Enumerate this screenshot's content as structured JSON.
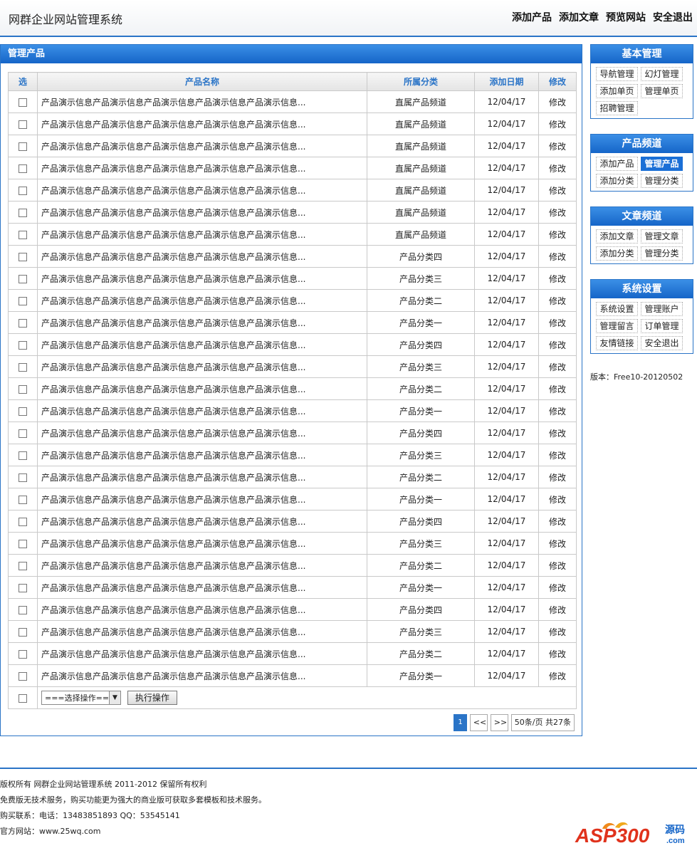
{
  "header": {
    "site_title": "网群企业网站管理系统",
    "nav": [
      "添加产品",
      "添加文章",
      "预览网站",
      "安全退出"
    ]
  },
  "main": {
    "title": "管理产品",
    "columns": [
      "选",
      "产品名称",
      "所属分类",
      "添加日期",
      "修改"
    ],
    "rows": [
      {
        "name": "产品演示信息产品演示信息产品演示信息产品演示信息产品演示信息...",
        "category": "直属产品频道",
        "date": "12/04/17",
        "edit": "修改"
      },
      {
        "name": "产品演示信息产品演示信息产品演示信息产品演示信息产品演示信息...",
        "category": "直属产品频道",
        "date": "12/04/17",
        "edit": "修改"
      },
      {
        "name": "产品演示信息产品演示信息产品演示信息产品演示信息产品演示信息...",
        "category": "直属产品频道",
        "date": "12/04/17",
        "edit": "修改"
      },
      {
        "name": "产品演示信息产品演示信息产品演示信息产品演示信息产品演示信息...",
        "category": "直属产品频道",
        "date": "12/04/17",
        "edit": "修改"
      },
      {
        "name": "产品演示信息产品演示信息产品演示信息产品演示信息产品演示信息...",
        "category": "直属产品频道",
        "date": "12/04/17",
        "edit": "修改"
      },
      {
        "name": "产品演示信息产品演示信息产品演示信息产品演示信息产品演示信息...",
        "category": "直属产品频道",
        "date": "12/04/17",
        "edit": "修改"
      },
      {
        "name": "产品演示信息产品演示信息产品演示信息产品演示信息产品演示信息...",
        "category": "直属产品频道",
        "date": "12/04/17",
        "edit": "修改"
      },
      {
        "name": "产品演示信息产品演示信息产品演示信息产品演示信息产品演示信息...",
        "category": "产品分类四",
        "date": "12/04/17",
        "edit": "修改"
      },
      {
        "name": "产品演示信息产品演示信息产品演示信息产品演示信息产品演示信息...",
        "category": "产品分类三",
        "date": "12/04/17",
        "edit": "修改"
      },
      {
        "name": "产品演示信息产品演示信息产品演示信息产品演示信息产品演示信息...",
        "category": "产品分类二",
        "date": "12/04/17",
        "edit": "修改"
      },
      {
        "name": "产品演示信息产品演示信息产品演示信息产品演示信息产品演示信息...",
        "category": "产品分类一",
        "date": "12/04/17",
        "edit": "修改"
      },
      {
        "name": "产品演示信息产品演示信息产品演示信息产品演示信息产品演示信息...",
        "category": "产品分类四",
        "date": "12/04/17",
        "edit": "修改"
      },
      {
        "name": "产品演示信息产品演示信息产品演示信息产品演示信息产品演示信息...",
        "category": "产品分类三",
        "date": "12/04/17",
        "edit": "修改"
      },
      {
        "name": "产品演示信息产品演示信息产品演示信息产品演示信息产品演示信息...",
        "category": "产品分类二",
        "date": "12/04/17",
        "edit": "修改"
      },
      {
        "name": "产品演示信息产品演示信息产品演示信息产品演示信息产品演示信息...",
        "category": "产品分类一",
        "date": "12/04/17",
        "edit": "修改"
      },
      {
        "name": "产品演示信息产品演示信息产品演示信息产品演示信息产品演示信息...",
        "category": "产品分类四",
        "date": "12/04/17",
        "edit": "修改"
      },
      {
        "name": "产品演示信息产品演示信息产品演示信息产品演示信息产品演示信息...",
        "category": "产品分类三",
        "date": "12/04/17",
        "edit": "修改"
      },
      {
        "name": "产品演示信息产品演示信息产品演示信息产品演示信息产品演示信息...",
        "category": "产品分类二",
        "date": "12/04/17",
        "edit": "修改"
      },
      {
        "name": "产品演示信息产品演示信息产品演示信息产品演示信息产品演示信息...",
        "category": "产品分类一",
        "date": "12/04/17",
        "edit": "修改"
      },
      {
        "name": "产品演示信息产品演示信息产品演示信息产品演示信息产品演示信息...",
        "category": "产品分类四",
        "date": "12/04/17",
        "edit": "修改"
      },
      {
        "name": "产品演示信息产品演示信息产品演示信息产品演示信息产品演示信息...",
        "category": "产品分类三",
        "date": "12/04/17",
        "edit": "修改"
      },
      {
        "name": "产品演示信息产品演示信息产品演示信息产品演示信息产品演示信息...",
        "category": "产品分类二",
        "date": "12/04/17",
        "edit": "修改"
      },
      {
        "name": "产品演示信息产品演示信息产品演示信息产品演示信息产品演示信息...",
        "category": "产品分类一",
        "date": "12/04/17",
        "edit": "修改"
      },
      {
        "name": "产品演示信息产品演示信息产品演示信息产品演示信息产品演示信息...",
        "category": "产品分类四",
        "date": "12/04/17",
        "edit": "修改"
      },
      {
        "name": "产品演示信息产品演示信息产品演示信息产品演示信息产品演示信息...",
        "category": "产品分类三",
        "date": "12/04/17",
        "edit": "修改"
      },
      {
        "name": "产品演示信息产品演示信息产品演示信息产品演示信息产品演示信息...",
        "category": "产品分类二",
        "date": "12/04/17",
        "edit": "修改"
      },
      {
        "name": "产品演示信息产品演示信息产品演示信息产品演示信息产品演示信息...",
        "category": "产品分类一",
        "date": "12/04/17",
        "edit": "修改"
      }
    ],
    "operation_select": "===选择操作===",
    "execute_button": "执行操作",
    "pager": {
      "current": "1",
      "prev": "<<",
      "next": ">>",
      "info": "50条/页 共27条"
    }
  },
  "sidebar": {
    "boxes": [
      {
        "title": "基本管理",
        "items": [
          "导航管理",
          "幻灯管理",
          "添加单页",
          "管理单页",
          "招聘管理"
        ]
      },
      {
        "title": "产品频道",
        "items": [
          "添加产品",
          "管理产品",
          "添加分类",
          "管理分类"
        ],
        "active": "管理产品"
      },
      {
        "title": "文章频道",
        "items": [
          "添加文章",
          "管理文章",
          "添加分类",
          "管理分类"
        ]
      },
      {
        "title": "系统设置",
        "items": [
          "系统设置",
          "管理账户",
          "管理留言",
          "订单管理",
          "友情链接",
          "安全退出"
        ]
      }
    ],
    "version": "版本：Free10-20120502"
  },
  "footer": {
    "lines": [
      "版权所有 网群企业网站管理系统 2011-2012 保留所有权利",
      "免费版无技术服务，购买功能更为强大的商业版可获取多套模板和技术服务。",
      "购买联系：电话：13483851893 QQ：53545141",
      "官方网站：www.25wq.com"
    ],
    "logo_text": "ASP300",
    "logo_suffix": "源码",
    "logo_domain": ".com"
  },
  "colors": {
    "accent": "#2a74c7",
    "panel_header": "#1565c8",
    "logo_red": "#e0321c"
  }
}
